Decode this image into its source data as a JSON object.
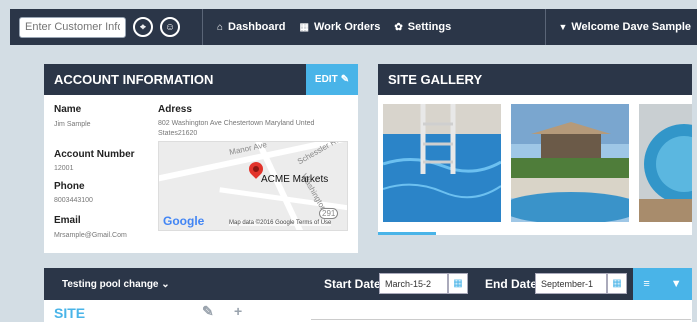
{
  "topbar": {
    "customer_input_placeholder": "Enter Customer Info...",
    "nav": [
      {
        "icon": "home-icon",
        "glyph": "⌂",
        "label": "Dashboard"
      },
      {
        "icon": "calendar-icon",
        "glyph": "▦",
        "label": "Work Orders"
      },
      {
        "icon": "gear-icon",
        "glyph": "✿",
        "label": "Settings"
      }
    ],
    "welcome": "Welcome Dave Sample"
  },
  "account": {
    "title": "ACCOUNT INFORMATION",
    "edit_label": "EDIT",
    "name_label": "Name",
    "name_value": "Jim Sample",
    "address_label": "Adress",
    "address_value": "802 Washington Ave Chestertown Maryland Unted States21620",
    "account_number_label": "Account Number",
    "account_number_value": "12001",
    "phone_label": "Phone",
    "phone_value": "8003443100",
    "email_label": "Email",
    "email_value": "Mrsample@Gmail.Com",
    "map": {
      "place_label": "ACME Markets",
      "street_manor": "Manor Ave",
      "street_schessler": "Schessler Rd",
      "street_washington": "Washington",
      "route_badge": "291",
      "google_label": "Google",
      "attribution": "Map data ©2016 Google  Terms of Use"
    }
  },
  "gallery": {
    "title": "SITE GALLERY"
  },
  "toolbar": {
    "pool_label": "Testing pool change",
    "start_date_label": "Start Date",
    "start_date_value": "March-15-2",
    "end_date_label": "End Date",
    "end_date_value": "September-1"
  },
  "site": {
    "title": "SITE"
  },
  "colors": {
    "navy": "#2b3648",
    "accent": "#49b4e8",
    "background": "#d3dde4"
  }
}
